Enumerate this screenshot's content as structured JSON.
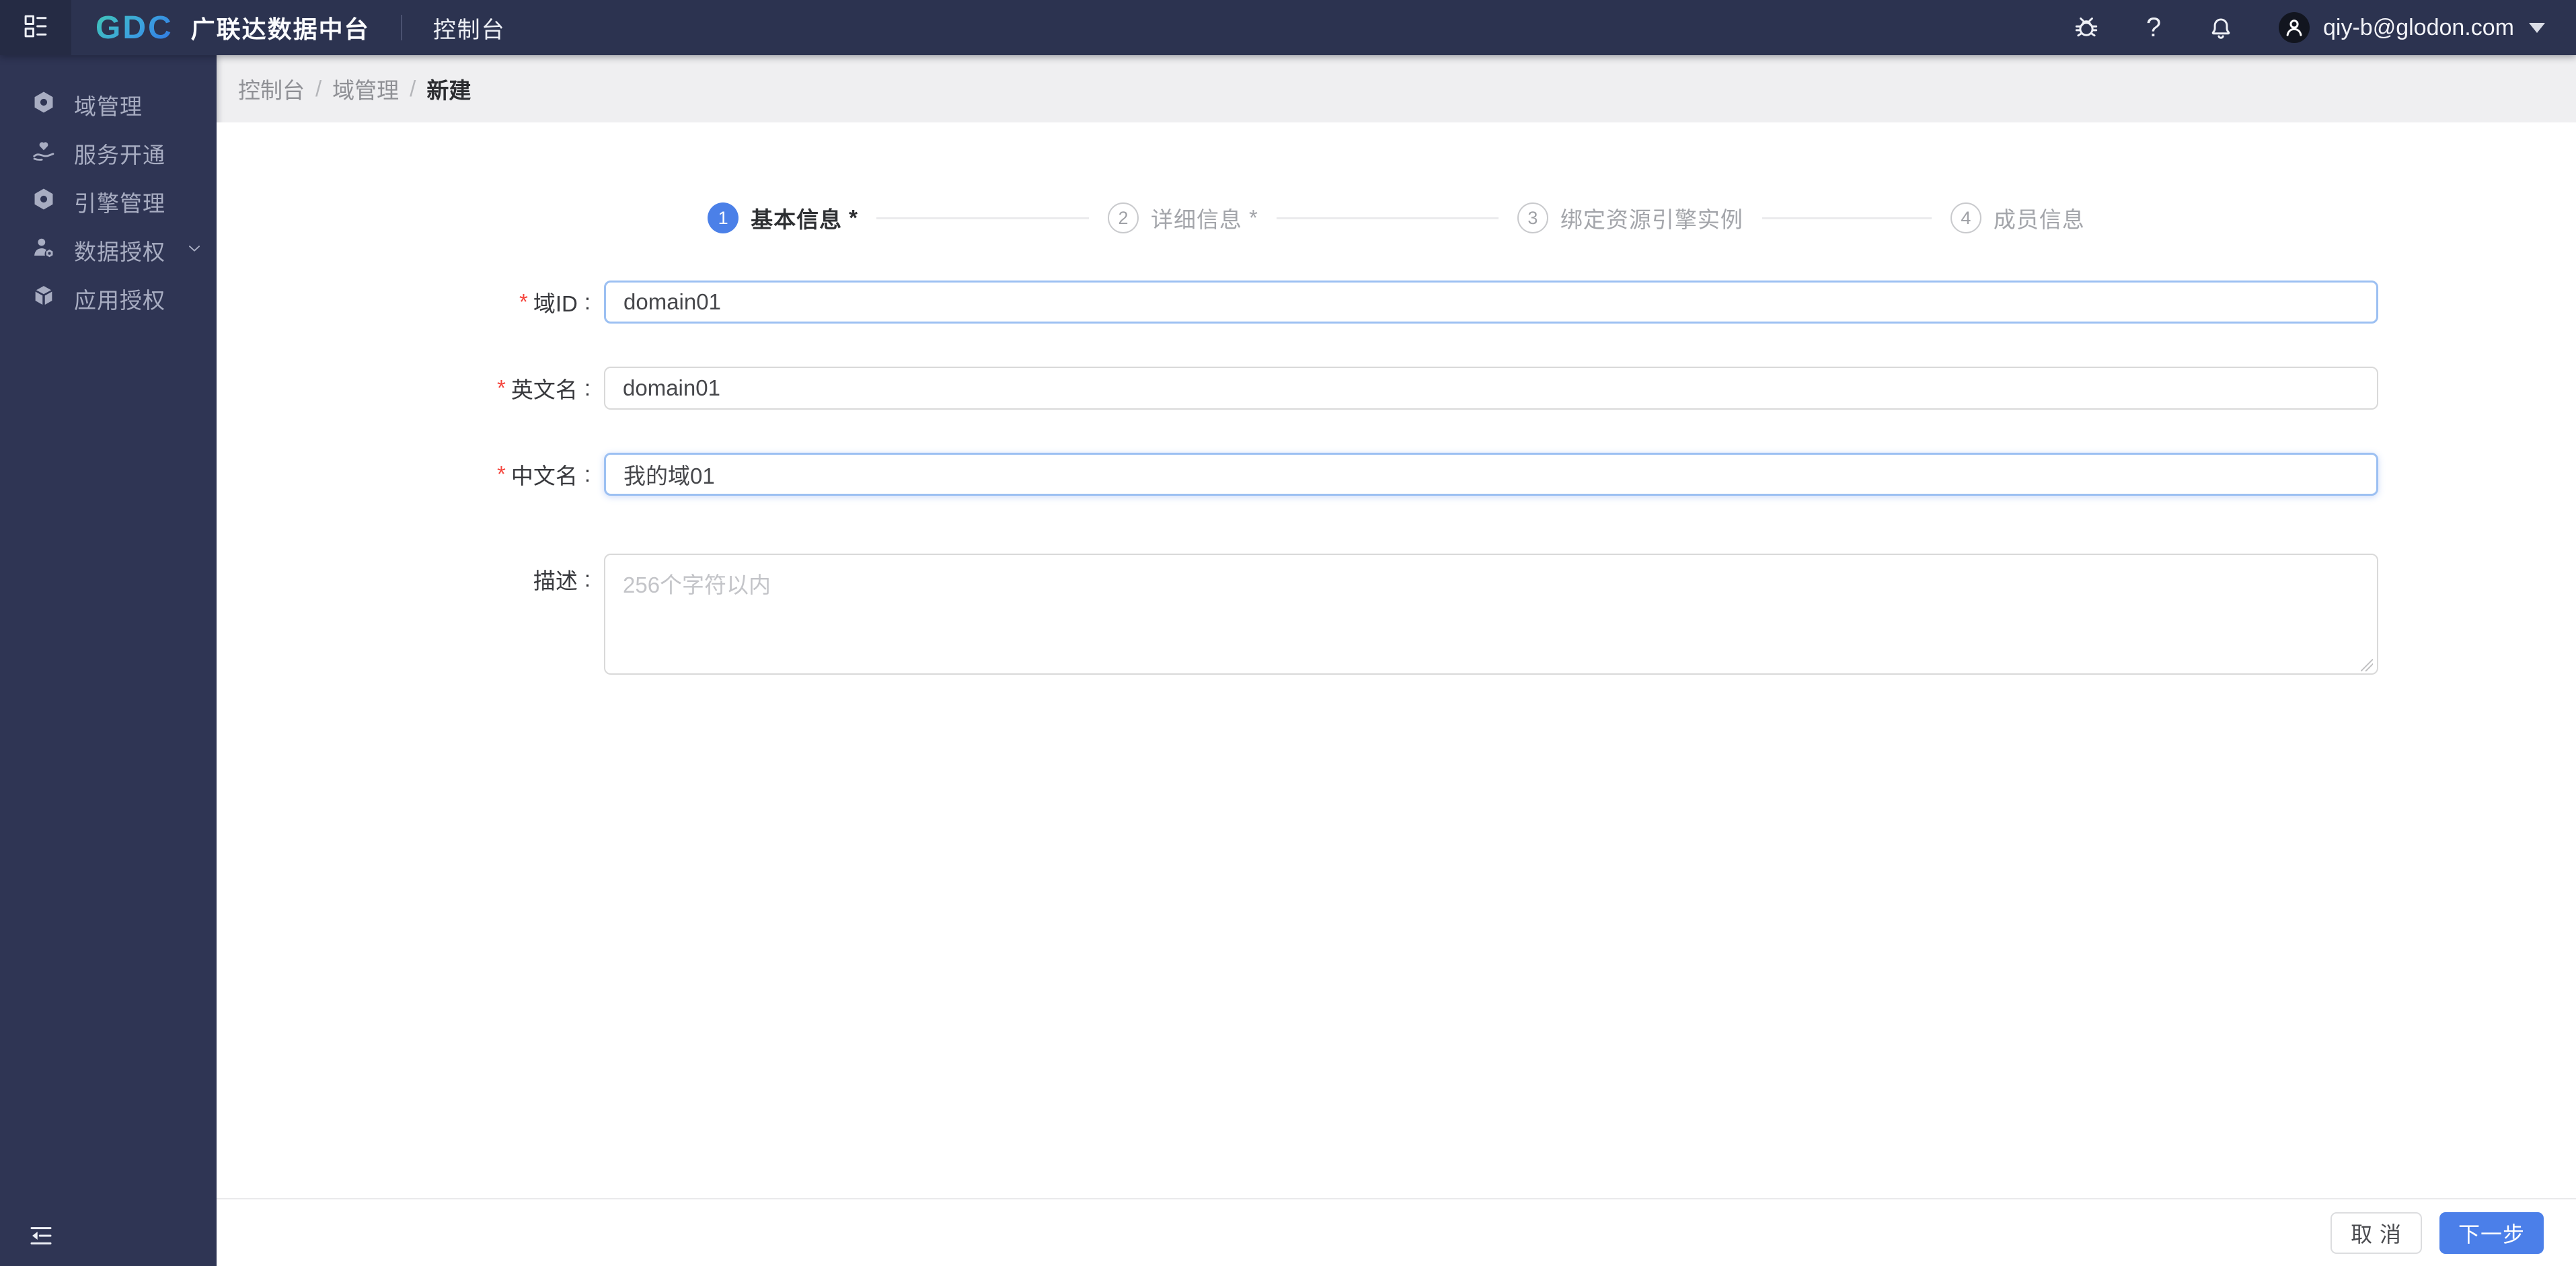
{
  "topbar": {
    "logo_text": "GDC",
    "product_name": "广联达数据中台",
    "nav_console": "控制台",
    "help_glyph": "?",
    "user_email": "qiy-b@glodon.com"
  },
  "sidebar": {
    "items": [
      {
        "label": "域管理",
        "icon": "hex-nut-icon"
      },
      {
        "label": "服务开通",
        "icon": "hand-heart-icon"
      },
      {
        "label": "引擎管理",
        "icon": "hex-nut-icon"
      },
      {
        "label": "数据授权",
        "icon": "user-gear-icon",
        "has_submenu": true
      },
      {
        "label": "应用授权",
        "icon": "cube-icon"
      }
    ]
  },
  "breadcrumb": {
    "sep": "/",
    "items": [
      "控制台",
      "域管理",
      "新建"
    ]
  },
  "stepper": {
    "steps": [
      {
        "num": "1",
        "label": "基本信息",
        "mark": "*",
        "state": "active"
      },
      {
        "num": "2",
        "label": "详细信息",
        "mark": "*",
        "state": "pending"
      },
      {
        "num": "3",
        "label": "绑定资源引擎实例",
        "mark": "",
        "state": "pending"
      },
      {
        "num": "4",
        "label": "成员信息",
        "mark": "",
        "state": "pending"
      }
    ]
  },
  "form": {
    "required_mark": "*",
    "colon": ":",
    "fields": [
      {
        "label": "域ID",
        "required": true,
        "value": "domain01",
        "style": "highlight"
      },
      {
        "label": "英文名",
        "required": true,
        "value": "domain01",
        "style": "normal"
      },
      {
        "label": "中文名",
        "required": true,
        "value": "我的域01",
        "style": "highlight-glow"
      }
    ],
    "description": {
      "label": "描述",
      "required": false,
      "value": "",
      "placeholder": "256个字符以内"
    }
  },
  "footer": {
    "cancel_label": "取 消",
    "next_label": "下一步"
  },
  "colors": {
    "accent_blue": "#4b7fe9",
    "topbar_bg": "#2c3350",
    "sidebar_bg": "#2f3554",
    "breadcrumb_bg": "#efeff1",
    "input_highlight_border": "#9cc0f2",
    "input_border": "#d9d9d9",
    "required_red": "#f5443c"
  }
}
